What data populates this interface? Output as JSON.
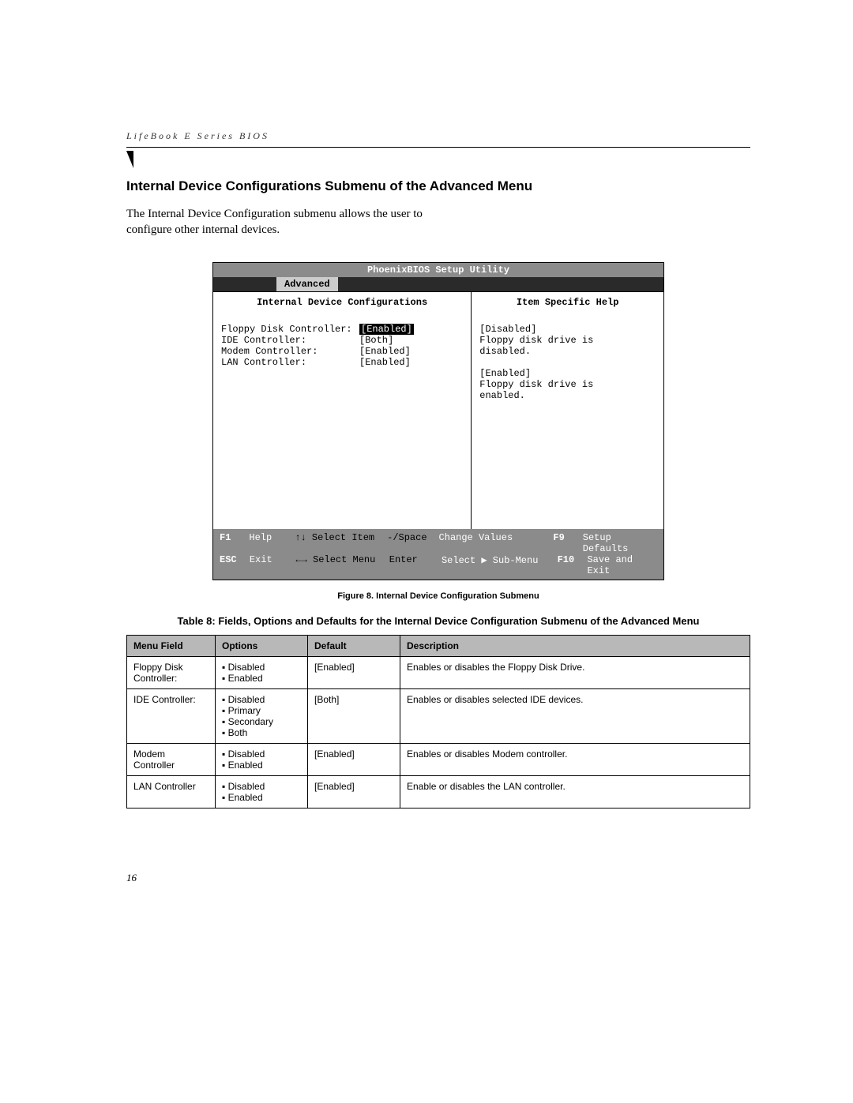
{
  "running_header": "LifeBook E Series BIOS",
  "section_title": "Internal Device Configurations Submenu of the Advanced Menu",
  "intro_text": "The Internal Device Configuration submenu allows the user to configure other internal devices.",
  "bios": {
    "title": "PhoenixBIOS Setup Utility",
    "active_tab": "Advanced",
    "left_title": "Internal Device Configurations",
    "right_title": "Item Specific Help",
    "rows": [
      {
        "label": "Floppy Disk Controller:",
        "value": "Enabled",
        "highlight": true
      },
      {
        "label": "IDE Controller:",
        "value": "[Both]",
        "highlight": false
      },
      {
        "label": "Modem Controller:",
        "value": "[Enabled]",
        "highlight": false
      },
      {
        "label": "LAN Controller:",
        "value": "[Enabled]",
        "highlight": false
      }
    ],
    "help_lines": [
      "[Disabled]",
      "Floppy disk drive is",
      "disabled.",
      "",
      "[Enabled]",
      "Floppy disk drive is",
      "enabled."
    ],
    "footer": {
      "l1": {
        "k1": "F1",
        "a1": "Help",
        "k2": "↑↓ Select Item",
        "k3": "-/Space",
        "a3": "Change Values",
        "k4": "F9",
        "a4": "Setup Defaults"
      },
      "l2": {
        "k1": "ESC",
        "a1": "Exit",
        "k2": "←→ Select Menu",
        "k3": "Enter",
        "a3": "Select ▶ Sub-Menu",
        "k4": "F10",
        "a4": "Save and Exit"
      }
    }
  },
  "figure_caption": "Figure 8.  Internal Device Configuration Submenu",
  "table_caption": "Table 8: Fields, Options and Defaults for the Internal Device Configuration Submenu of the Advanced Menu",
  "table": {
    "headers": [
      "Menu Field",
      "Options",
      "Default",
      "Description"
    ],
    "rows": [
      {
        "menu": "Floppy Disk Controller:",
        "options": [
          "Disabled",
          "Enabled"
        ],
        "def": "[Enabled]",
        "desc": "Enables or disables the Floppy Disk Drive."
      },
      {
        "menu": "IDE Controller:",
        "options": [
          "Disabled",
          "Primary",
          "Secondary",
          "Both"
        ],
        "def": "[Both]",
        "desc": "Enables or disables selected IDE devices."
      },
      {
        "menu": "Modem Controller",
        "options": [
          "Disabled",
          "Enabled"
        ],
        "def": "[Enabled]",
        "desc": "Enables or disables Modem controller."
      },
      {
        "menu": "LAN Controller",
        "options": [
          "Disabled",
          "Enabled"
        ],
        "def": "[Enabled]",
        "desc": "Enable or disables the LAN controller."
      }
    ]
  },
  "page_number": "16"
}
